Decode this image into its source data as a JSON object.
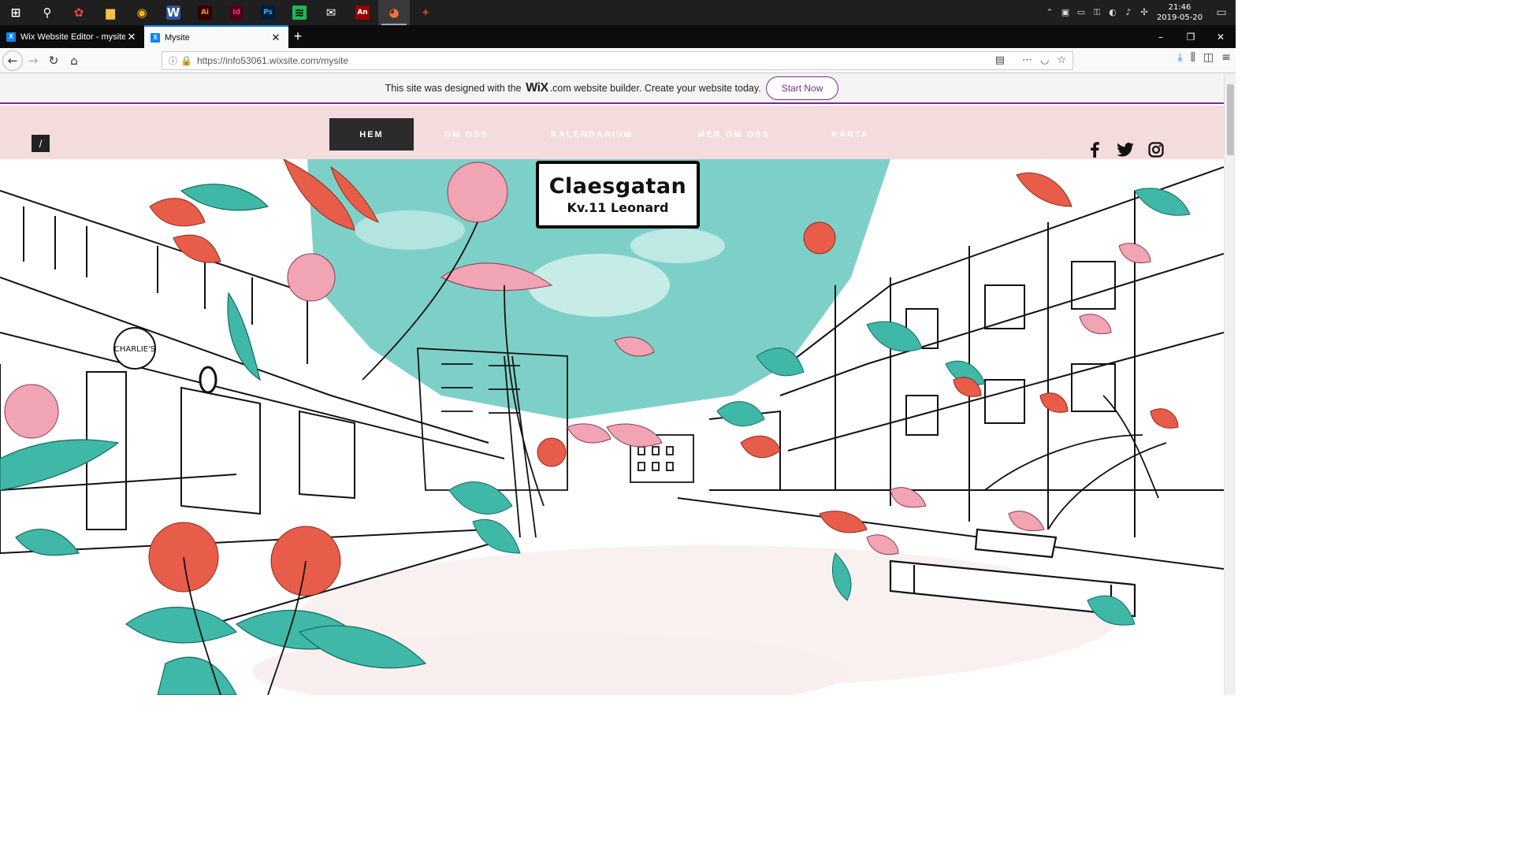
{
  "taskbar": {
    "apps": [
      {
        "name": "windows-start",
        "glyph": "⊞",
        "color": "#ffffff",
        "bg": "transparent"
      },
      {
        "name": "search",
        "glyph": "⚲",
        "color": "#ffffff",
        "bg": "transparent"
      },
      {
        "name": "app-paint",
        "glyph": "✿",
        "color": "#e44",
        "bg": "transparent"
      },
      {
        "name": "file-explorer",
        "glyph": "▆",
        "color": "#f5c342",
        "bg": "transparent"
      },
      {
        "name": "chrome",
        "glyph": "◉",
        "color": "#fbbc05",
        "bg": "transparent"
      },
      {
        "name": "word",
        "glyph": "W",
        "color": "#ffffff",
        "bg": "#2b579a"
      },
      {
        "name": "illustrator",
        "glyph": "Ai",
        "color": "#ff9a00",
        "bg": "#330000"
      },
      {
        "name": "indesign",
        "glyph": "Id",
        "color": "#ff3366",
        "bg": "#49021f"
      },
      {
        "name": "photoshop",
        "glyph": "Ps",
        "color": "#31a8ff",
        "bg": "#001e36"
      },
      {
        "name": "spotify",
        "glyph": "≋",
        "color": "#000000",
        "bg": "#1db954"
      },
      {
        "name": "mail",
        "glyph": "✉",
        "color": "#ffffff",
        "bg": "transparent"
      },
      {
        "name": "animate",
        "glyph": "An",
        "color": "#ffffff",
        "bg": "#9a0000"
      },
      {
        "name": "firefox",
        "glyph": "◕",
        "color": "#ff7139",
        "bg": "transparent"
      },
      {
        "name": "app-red",
        "glyph": "✦",
        "color": "#c0392b",
        "bg": "transparent"
      }
    ],
    "active_app": "firefox",
    "tray_glyphs": [
      "⌃",
      "▣",
      "▭",
      "⚿",
      "◐",
      "♪",
      "✣"
    ],
    "time": "21:46",
    "date": "2019-05-20"
  },
  "tabs": [
    {
      "title": "Wix Website Editor - mysite",
      "active": false
    },
    {
      "title": "Mysite",
      "active": true
    }
  ],
  "navbar": {
    "url": "https://info53061.wixsite.com/mysite"
  },
  "wix_banner": {
    "text_before": "This site was designed with the",
    "logo": "WiX",
    "logo_suffix": ".com",
    "text_after": "website builder. Create your website today.",
    "button_label": "Start Now"
  },
  "site": {
    "menu_toggle_label": "/",
    "menu": [
      {
        "label": "HEM",
        "active": true
      },
      {
        "label": "OM OSS",
        "active": false
      },
      {
        "label": "KALENDARIUM",
        "active": false
      },
      {
        "label": "MER OM OSS",
        "active": false
      },
      {
        "label": "KARTA",
        "active": false
      }
    ],
    "social": [
      "facebook-icon",
      "twitter-icon",
      "instagram-icon"
    ],
    "sign": {
      "line1": "Claesgatan",
      "line2": "Kv.11 Leonard"
    },
    "shop_sign": "CHARLIE'S"
  },
  "colors": {
    "header_bg": "#f4dcdc",
    "banner_accent": "#7b2a8b",
    "sky": "#79cfc6",
    "leaf_teal": "#3fb8a8",
    "flower_red": "#e85c4a",
    "flower_pink": "#f0a4b4"
  }
}
